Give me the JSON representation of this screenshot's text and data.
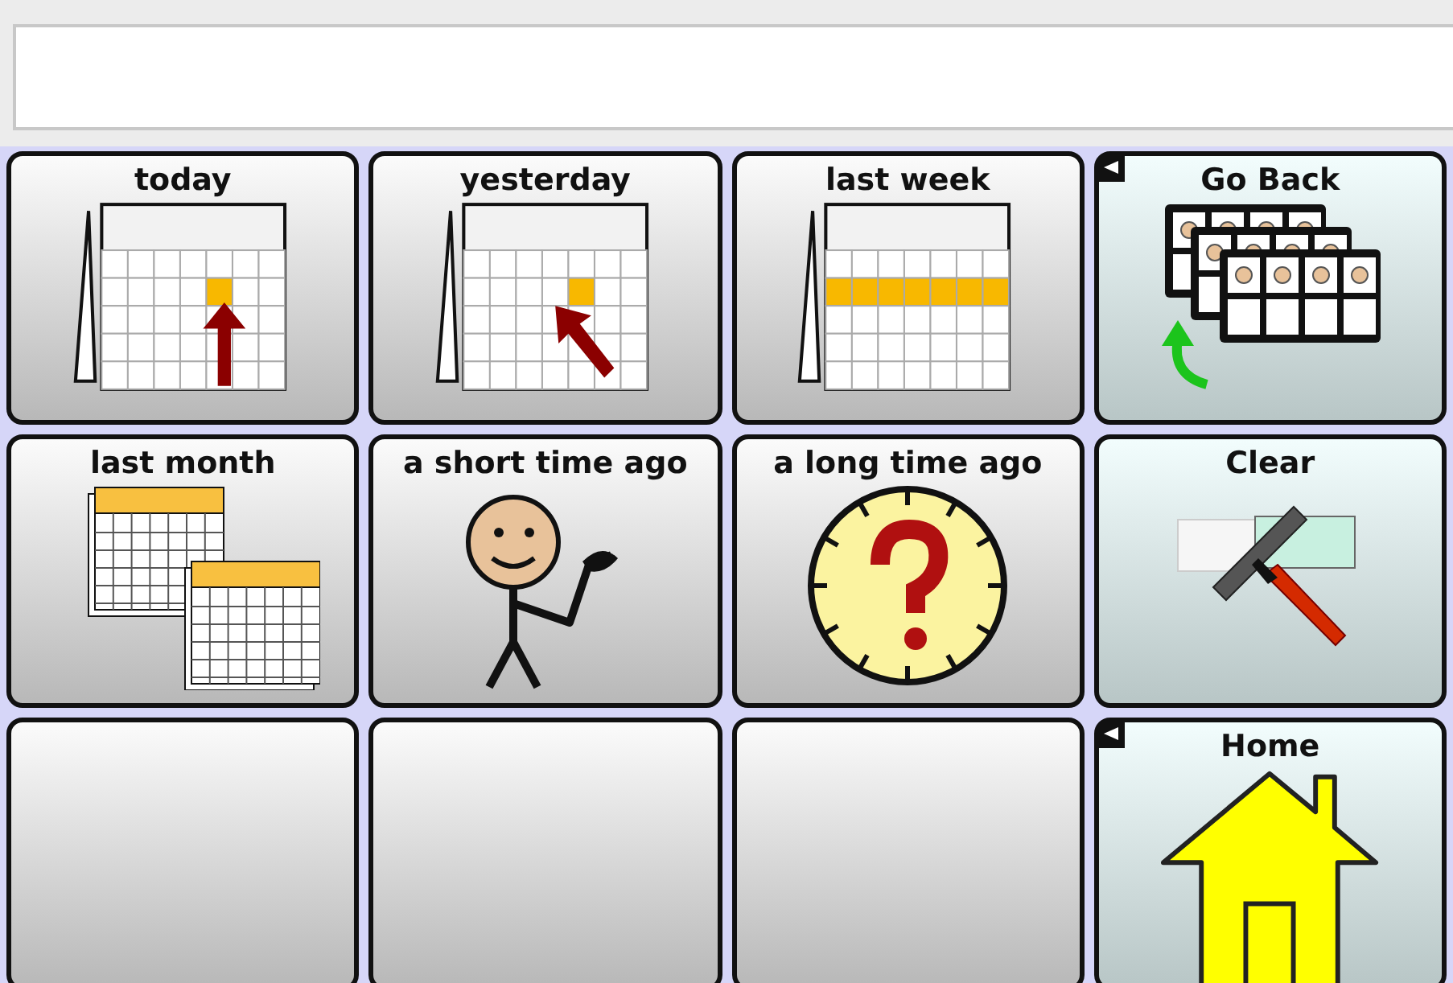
{
  "message_bar": {
    "kind": "empty"
  },
  "cells": [
    {
      "label": "today",
      "kind": "word",
      "icon": {
        "kind": "calendar-day"
      },
      "link": false
    },
    {
      "label": "yesterday",
      "kind": "word",
      "icon": {
        "kind": "calendar-previous-day"
      },
      "link": false
    },
    {
      "label": "last week",
      "kind": "word",
      "icon": {
        "kind": "calendar-week"
      },
      "link": false
    },
    {
      "label": "Go Back",
      "kind": "action",
      "icon": {
        "kind": "pages-back"
      },
      "link": true
    },
    {
      "label": "last month",
      "kind": "word",
      "icon": {
        "kind": "calendars"
      },
      "link": false
    },
    {
      "label": "a short time ago",
      "kind": "word",
      "icon": {
        "kind": "person-pointing-back"
      },
      "link": false
    },
    {
      "label": "a long time ago",
      "kind": "word",
      "icon": {
        "kind": "clock-question"
      },
      "link": false
    },
    {
      "label": "Clear",
      "kind": "action",
      "icon": {
        "kind": "eraser"
      },
      "link": false
    },
    {
      "kind": "empty"
    },
    {
      "kind": "empty"
    },
    {
      "kind": "empty"
    },
    {
      "label": "Home",
      "kind": "action",
      "icon": {
        "kind": "house"
      },
      "link": true
    }
  ]
}
